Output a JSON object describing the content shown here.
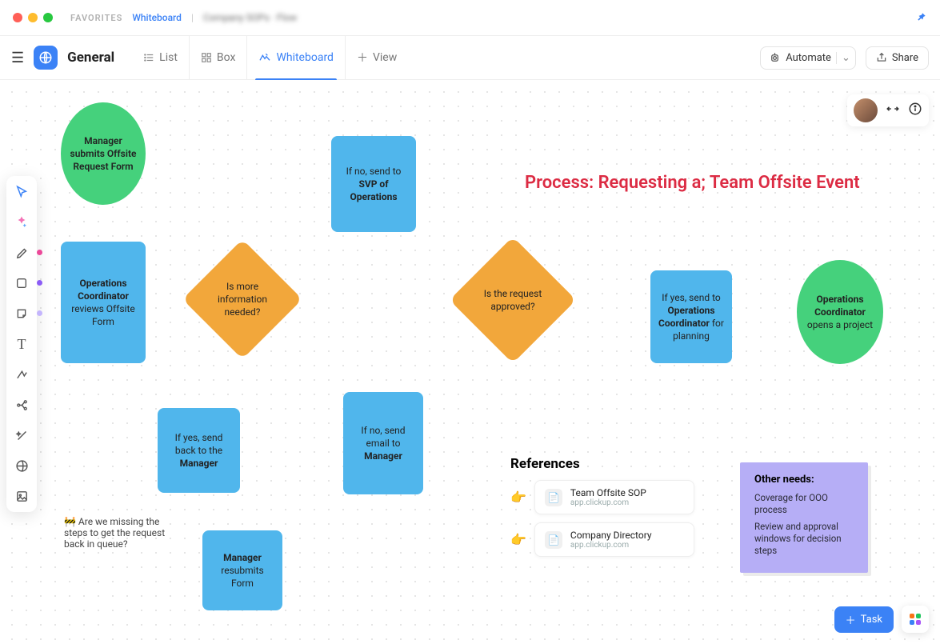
{
  "breadcrumb": {
    "favorites": "FAVORITES",
    "item": "Whiteboard",
    "blurred": "Company SOPs · Flow"
  },
  "header": {
    "space": "General",
    "tabs": {
      "list": "List",
      "box": "Box",
      "whiteboard": "Whiteboard",
      "addview": "View"
    },
    "automate": "Automate",
    "share": "Share"
  },
  "title": "Process: Requesting a; Team Offsite Event",
  "nodes": {
    "start": {
      "l1": "Manager submits Offsite Request Form"
    },
    "review": {
      "l1": "Operations Coordinator",
      "l2": " reviews Offsite Form"
    },
    "moreinfo": {
      "q": "Is more information needed?"
    },
    "svp": {
      "l1": "If no, send to ",
      "l2": "SVP of Operations"
    },
    "sendback": {
      "l1": "If yes, send back to the ",
      "l2": "Manager"
    },
    "resubmit": {
      "l1": "Manager",
      "l2": " resubmits Form"
    },
    "noemail": {
      "l1": "If no, send email to ",
      "l2": "Manager"
    },
    "approved": {
      "q": "Is the request approved?"
    },
    "plan": {
      "l1": "If yes, send to ",
      "l2": "Operations Coordinator",
      "l3": " for planning"
    },
    "open": {
      "l1": "Operations Coordinator",
      "l2": " opens a project"
    }
  },
  "comment": "🚧 Are we missing the steps to get the request back in queue?",
  "refs": {
    "heading": "References",
    "items": [
      {
        "emoji": "👉",
        "title": "Team Offsite SOP",
        "sub": "app.clickup.com"
      },
      {
        "emoji": "👉",
        "title": "Company Directory",
        "sub": "app.clickup.com"
      }
    ]
  },
  "needs": {
    "heading": "Other needs:",
    "items": [
      "Coverage for OOO process",
      "Review and approval windows for decision steps"
    ]
  },
  "taskbtn": "Task"
}
